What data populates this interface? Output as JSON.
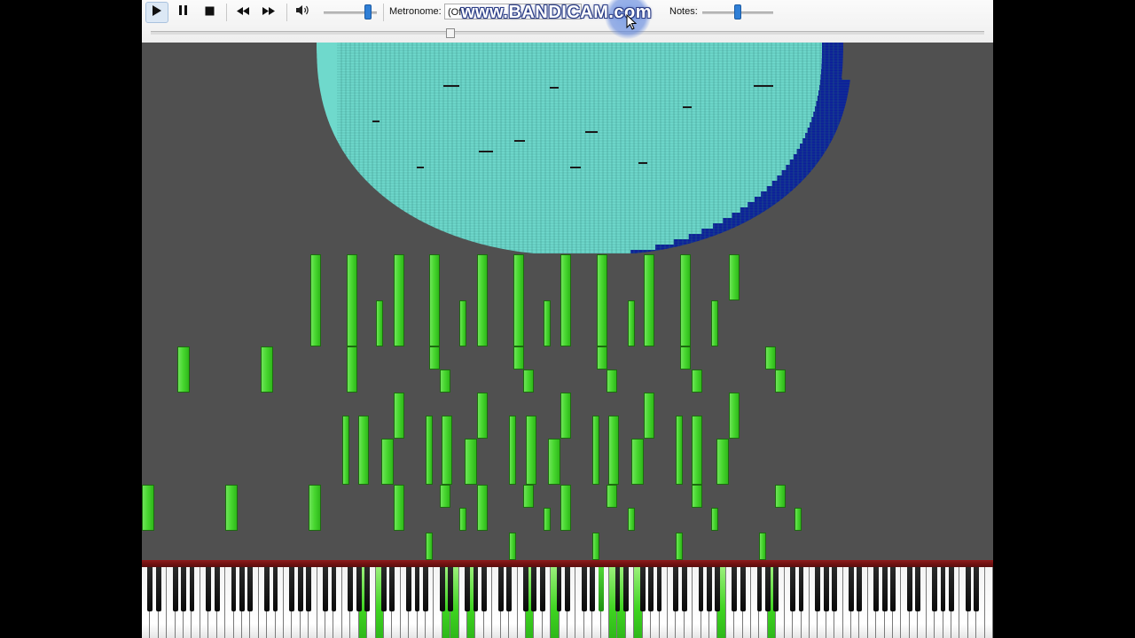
{
  "toolbar": {
    "play_icon": "play-icon",
    "pause_icon": "pause-icon",
    "stop_icon": "stop-icon",
    "rewind_icon": "rewind-icon",
    "fast_forward_icon": "fast-forward-icon",
    "volume_icon": "speaker-icon",
    "volume_level": 0.82,
    "metronome_label": "Metronome:",
    "metronome_value": "(Off)",
    "notes_label": "Notes:",
    "notes_level": 0.5,
    "playback_progress": 0.36
  },
  "watermark": "www.BANDICAM.com",
  "colors": {
    "active_note": "#3ed420",
    "dense_block_light": "#6fd9cc",
    "dense_block_dark": "#0c1f9a",
    "roll_background": "#505050",
    "keyboard_edge": "#8e1b1b"
  }
}
